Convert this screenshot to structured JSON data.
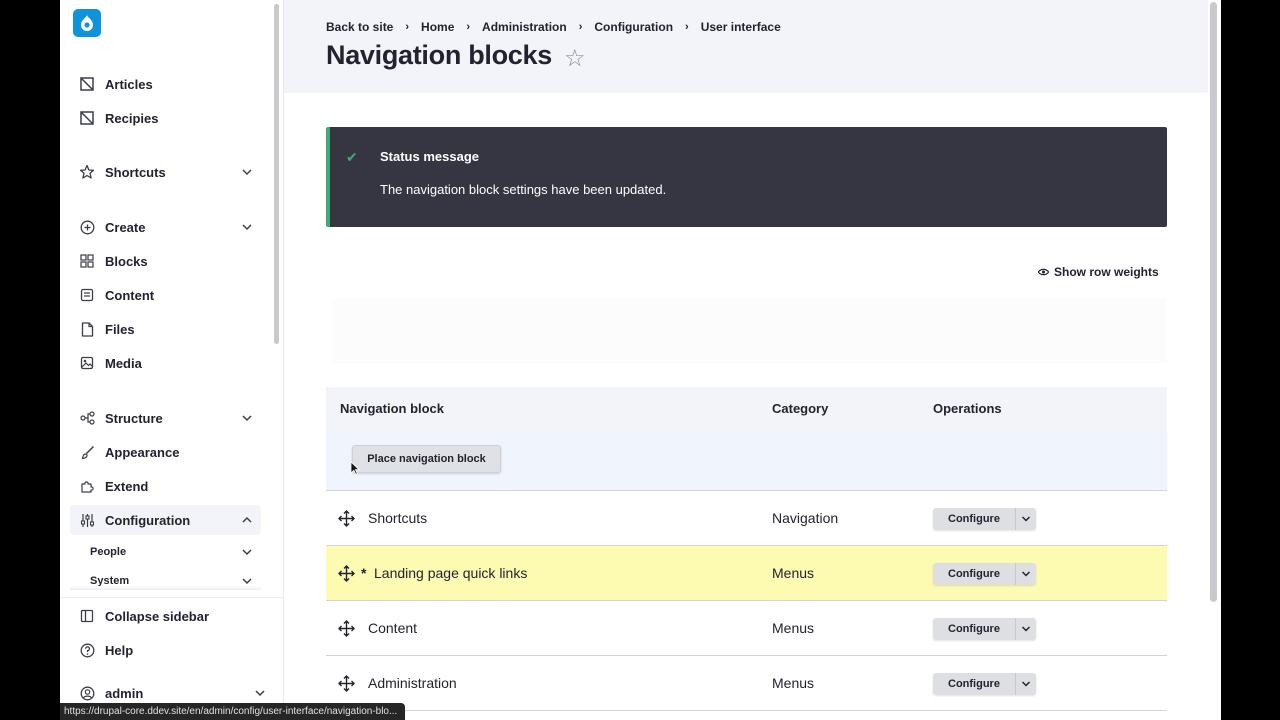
{
  "sidebar": {
    "top_items": [
      {
        "label": "Articles",
        "icon": "article-icon"
      },
      {
        "label": "Recipies",
        "icon": "recipe-icon"
      }
    ],
    "shortcuts": {
      "label": "Shortcuts",
      "icon": "star-icon"
    },
    "items": [
      {
        "label": "Create",
        "icon": "plus-circle-icon"
      },
      {
        "label": "Blocks",
        "icon": "blocks-grid-icon"
      },
      {
        "label": "Content",
        "icon": "content-icon"
      },
      {
        "label": "Files",
        "icon": "file-icon"
      },
      {
        "label": "Media",
        "icon": "media-icon"
      },
      {
        "label": "Structure",
        "icon": "structure-icon"
      },
      {
        "label": "Appearance",
        "icon": "brush-icon"
      },
      {
        "label": "Extend",
        "icon": "puzzle-icon"
      },
      {
        "label": "Configuration",
        "icon": "sliders-icon"
      }
    ],
    "sub_items": [
      {
        "label": "People"
      },
      {
        "label": "System"
      }
    ],
    "collapse_label": "Collapse sidebar",
    "help_label": "Help",
    "user_label": "admin"
  },
  "breadcrumb": [
    "Back to site",
    "Home",
    "Administration",
    "Configuration",
    "User interface"
  ],
  "page_title": "Navigation blocks",
  "status": {
    "title": "Status message",
    "message": "The navigation block settings have been updated."
  },
  "show_row_weights_label": "Show row weights",
  "table": {
    "headers": [
      "Navigation block",
      "Category",
      "Operations"
    ],
    "place_button_label": "Place navigation block",
    "rows": [
      {
        "name": "Shortcuts",
        "category": "Navigation",
        "operation": "Configure",
        "changed": ""
      },
      {
        "name": "Landing page quick links",
        "category": "Menus",
        "operation": "Configure",
        "changed": "*"
      },
      {
        "name": "Content",
        "category": "Menus",
        "operation": "Configure",
        "changed": ""
      },
      {
        "name": "Administration",
        "category": "Menus",
        "operation": "Configure",
        "changed": ""
      }
    ]
  },
  "status_url": "https://drupal-core.ddev.site/en/admin/config/user-interface/navigation-blo...",
  "colors": {
    "brand": "#1193d9",
    "status_bg": "#353641",
    "status_accent": "#42a877",
    "highlight_row": "#fdfbb2",
    "header_bg": "#f3f4f9"
  }
}
